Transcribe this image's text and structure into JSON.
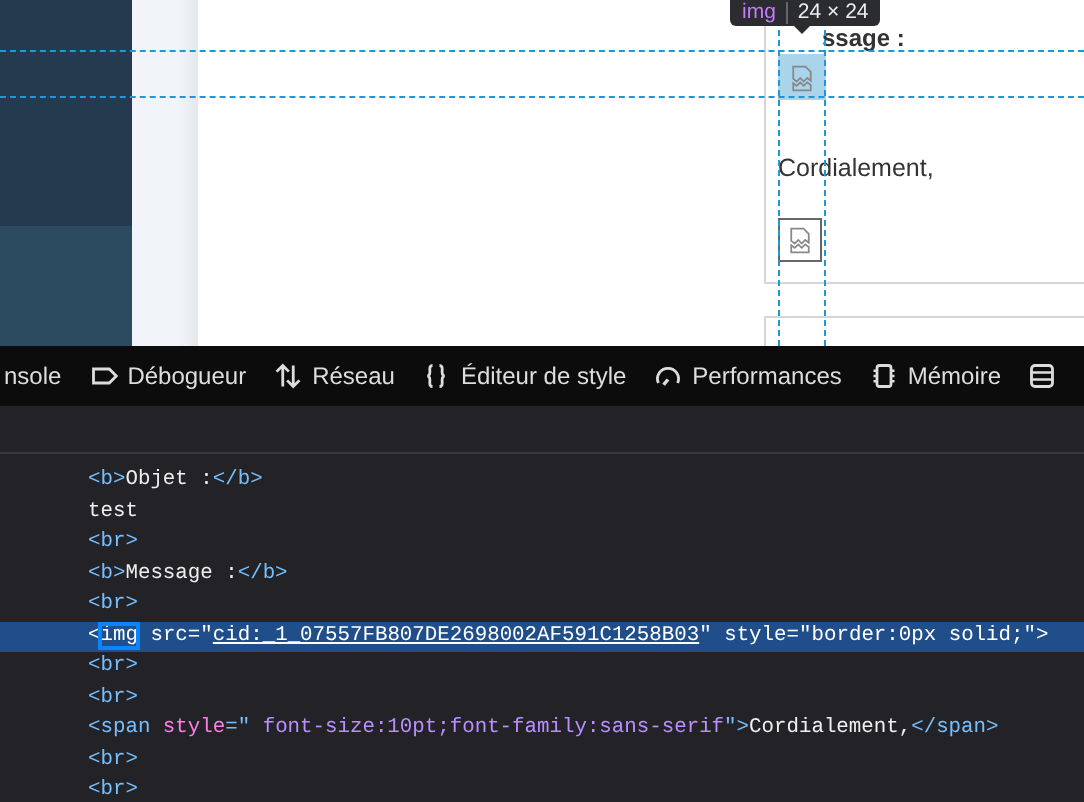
{
  "preview": {
    "heading": "ssage :",
    "closing": "Cordialement,",
    "tooltip": {
      "tag": "img",
      "size": "24 × 24"
    }
  },
  "toolbar": {
    "tabs": [
      {
        "label": "nsole",
        "selected": false
      },
      {
        "label": "Débogueur",
        "selected": false
      },
      {
        "label": "Réseau",
        "selected": false
      },
      {
        "label": "Éditeur de style",
        "selected": false
      },
      {
        "label": "Performances",
        "selected": false
      },
      {
        "label": "Mémoire",
        "selected": false
      }
    ]
  },
  "markup": {
    "lines": [
      {
        "selected": false,
        "parts": [
          {
            "kind": "tag",
            "text": "<b>"
          },
          {
            "kind": "text",
            "text": "Objet :"
          },
          {
            "kind": "tag",
            "text": "</b>"
          }
        ]
      },
      {
        "selected": false,
        "parts": [
          {
            "kind": "text",
            "text": "test"
          }
        ]
      },
      {
        "selected": false,
        "parts": [
          {
            "kind": "tag",
            "text": "<br>"
          }
        ]
      },
      {
        "selected": false,
        "parts": [
          {
            "kind": "tag",
            "text": "<b>"
          },
          {
            "kind": "text",
            "text": "Message :"
          },
          {
            "kind": "tag",
            "text": "</b>"
          }
        ]
      },
      {
        "selected": false,
        "parts": [
          {
            "kind": "tag",
            "text": "<br>"
          }
        ]
      },
      {
        "selected": true,
        "parts": [
          {
            "kind": "tag",
            "text": "<"
          },
          {
            "kind": "focus",
            "text": "img"
          },
          {
            "kind": "attr",
            "text": " src"
          },
          {
            "kind": "tag",
            "text": "=\""
          },
          {
            "kind": "link",
            "text": "cid:_1_07557FB807DE2698002AF591C1258B03"
          },
          {
            "kind": "tag",
            "text": "\""
          },
          {
            "kind": "attr",
            "text": " style"
          },
          {
            "kind": "tag",
            "text": "=\""
          },
          {
            "kind": "value",
            "text": "border:0px solid;"
          },
          {
            "kind": "tag",
            "text": "\">"
          }
        ]
      },
      {
        "selected": false,
        "parts": [
          {
            "kind": "tag",
            "text": "<br>"
          }
        ]
      },
      {
        "selected": false,
        "parts": [
          {
            "kind": "tag",
            "text": "<br>"
          }
        ]
      },
      {
        "selected": false,
        "parts": [
          {
            "kind": "tag",
            "text": "<span"
          },
          {
            "kind": "attr",
            "text": " style"
          },
          {
            "kind": "tag",
            "text": "=\""
          },
          {
            "kind": "value",
            "text": " font-size:10pt;font-family:sans-serif"
          },
          {
            "kind": "tag",
            "text": "\">"
          },
          {
            "kind": "text",
            "text": "Cordialement,"
          },
          {
            "kind": "tag",
            "text": "</span>"
          }
        ]
      },
      {
        "selected": false,
        "parts": [
          {
            "kind": "tag",
            "text": "<br>"
          }
        ]
      },
      {
        "selected": false,
        "parts": [
          {
            "kind": "tag",
            "text": "<br>"
          }
        ]
      }
    ]
  }
}
